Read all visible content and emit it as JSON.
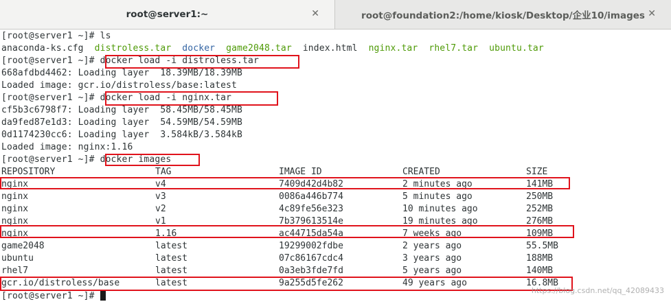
{
  "tabs": [
    {
      "title": "root@server1:~",
      "close": "✕"
    },
    {
      "title": "root@foundation2:/home/kiosk/Desktop/企业10/images",
      "close": "✕"
    }
  ],
  "terminal": {
    "prompt": "[root@server1 ~]# ",
    "cmd_ls": "ls",
    "files": [
      {
        "name": "anaconda-ks.cfg",
        "color": "default"
      },
      {
        "name": "distroless.tar",
        "color": "green"
      },
      {
        "name": "docker",
        "color": "blue"
      },
      {
        "name": "game2048.tar",
        "color": "green"
      },
      {
        "name": "index.html",
        "color": "default"
      },
      {
        "name": "nginx.tar",
        "color": "green"
      },
      {
        "name": "rhel7.tar",
        "color": "green"
      },
      {
        "name": "ubuntu.tar",
        "color": "green"
      }
    ],
    "cmd_load_distroless": "docker load -i distroless.tar",
    "out_distroless_layer": "668afdbd4462: Loading layer  18.39MB/18.39MB",
    "out_distroless_loaded": "Loaded image: gcr.io/distroless/base:latest",
    "cmd_load_nginx": "docker load -i nginx.tar",
    "out_nginx_layer1": "cf5b3c6798f7: Loading layer  58.45MB/58.45MB",
    "out_nginx_layer2": "da9fed87e1d3: Loading layer  54.59MB/54.59MB",
    "out_nginx_layer3": "0d1174230cc6: Loading layer  3.584kB/3.584kB",
    "out_nginx_loaded": "Loaded image: nginx:1.16",
    "cmd_images": "docker images",
    "table_headers": [
      "REPOSITORY",
      "TAG",
      "IMAGE ID",
      "CREATED",
      "SIZE"
    ],
    "rows": [
      [
        "nginx",
        "v4",
        "7409d42d4b82",
        "2 minutes ago",
        "141MB"
      ],
      [
        "nginx",
        "v3",
        "0086a446b774",
        "5 minutes ago",
        "250MB"
      ],
      [
        "nginx",
        "v2",
        "4c89fe56e323",
        "10 minutes ago",
        "252MB"
      ],
      [
        "nginx",
        "v1",
        "7b379613514e",
        "19 minutes ago",
        "276MB"
      ],
      [
        "nginx",
        "1.16",
        "ac44715da54a",
        "7 weeks ago",
        "109MB"
      ],
      [
        "game2048",
        "latest",
        "19299002fdbe",
        "2 years ago",
        "55.5MB"
      ],
      [
        "ubuntu",
        "latest",
        "07c86167cdc4",
        "3 years ago",
        "188MB"
      ],
      [
        "rhel7",
        "latest",
        "0a3eb3fde7fd",
        "5 years ago",
        "140MB"
      ],
      [
        "gcr.io/distroless/base",
        "latest",
        "9a255d5fe262",
        "49 years ago",
        "16.8MB"
      ]
    ]
  },
  "watermark": "https://blog.csdn.net/qq_42089433",
  "colors": {
    "highlight_box": "#e0121b",
    "exec_green": "#4e9a06",
    "dir_blue": "#3465a4"
  }
}
